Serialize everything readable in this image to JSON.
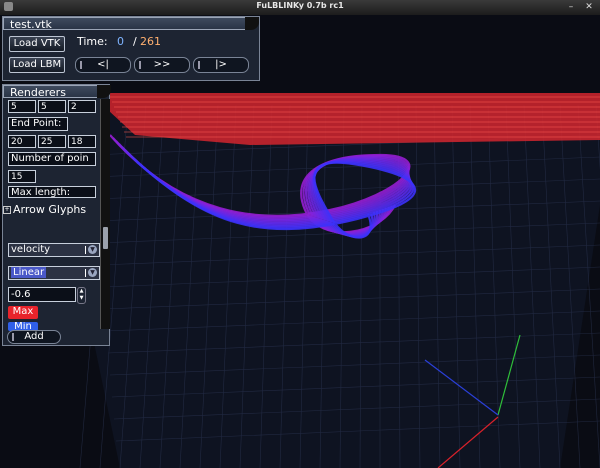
{
  "window": {
    "title": "FuLBLINKy 0.7b rc1",
    "minimize": "–",
    "close": "✕"
  },
  "file_panel": {
    "filename": "test.vtk",
    "load_vtk": "Load VTK",
    "load_lbm": "Load LBM",
    "time_label": "Time:",
    "time_current": "0",
    "time_separator": "/",
    "time_total": "261",
    "nav_first": "<|",
    "nav_play": ">>",
    "nav_last": "|>"
  },
  "renderers_panel": {
    "title": "Renderers",
    "start_point": [
      "5",
      "5",
      "2"
    ],
    "end_point_label": "End Point:",
    "end_point": [
      "20",
      "25",
      "18"
    ],
    "num_points_label": "Number of poin",
    "num_points": "15",
    "max_length_label": "Max length:",
    "arrow_glyphs": "Arrow Glyphs",
    "expand_icon": "+",
    "field_select": "velocity",
    "interp_select": "Linear",
    "value_input": "-0.6",
    "max_label": "Max",
    "min_label": "Min",
    "add_button": "Add",
    "colors": {
      "max": "#e8232b",
      "min": "#2f5fe8",
      "select_highlight": "#4a58c8"
    }
  },
  "axes": {
    "x_color": "#d8212a",
    "y_color": "#2fbf3a",
    "z_color": "#2a3fd8"
  }
}
